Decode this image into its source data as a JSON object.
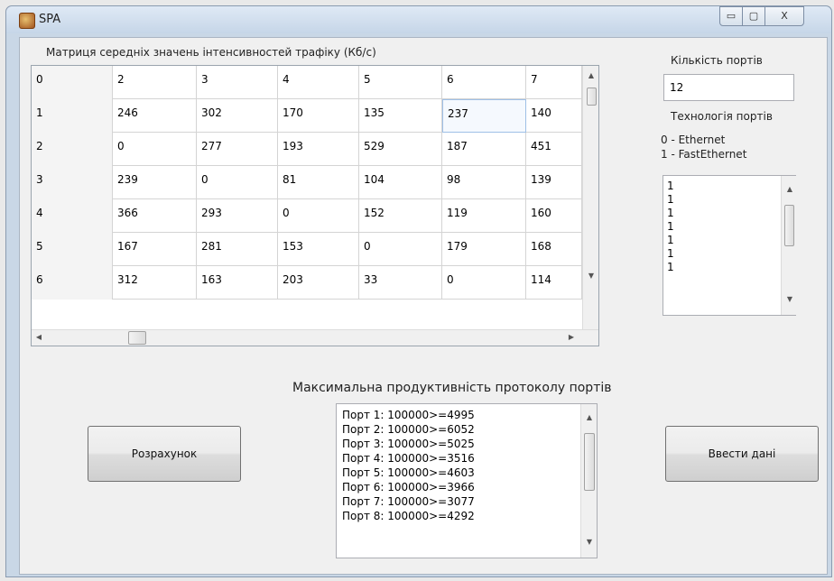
{
  "window": {
    "title": "SPA",
    "min_glyph": "▭",
    "max_glyph": "▢",
    "close_glyph": "X"
  },
  "matrix": {
    "title": "Матриця середніх значень інтенсивностей трафіку (Кб/с)",
    "columns": [
      "0",
      "2",
      "3",
      "4",
      "5",
      "6",
      "7"
    ],
    "rows": [
      [
        "1",
        "246",
        "302",
        "170",
        "135",
        "237",
        "140"
      ],
      [
        "2",
        "0",
        "277",
        "193",
        "529",
        "187",
        "451"
      ],
      [
        "3",
        "239",
        "0",
        "81",
        "104",
        "98",
        "139"
      ],
      [
        "4",
        "366",
        "293",
        "0",
        "152",
        "119",
        "160"
      ],
      [
        "5",
        "167",
        "281",
        "153",
        "0",
        "179",
        "168"
      ],
      [
        "6",
        "312",
        "163",
        "203",
        "33",
        "0",
        "114"
      ]
    ]
  },
  "ports": {
    "count_label": "Кількість портів",
    "count_value": "12",
    "tech_label": "Технологія портів",
    "tech_legend": [
      "0 - Ethernet",
      "1 - FastEthernet"
    ],
    "tech_values": [
      "1",
      "1",
      "1",
      "1",
      "1",
      "1",
      "1"
    ]
  },
  "output": {
    "title": "Максимальна продуктивність протоколу портів",
    "lines": [
      "Порт 1: 100000>=4995",
      "Порт 2: 100000>=6052",
      "Порт 3: 100000>=5025",
      "Порт 4: 100000>=3516",
      "Порт 5: 100000>=4603",
      "Порт 6: 100000>=3966",
      "Порт 7: 100000>=3077",
      "Порт 8: 100000>=4292"
    ]
  },
  "buttons": {
    "calculate": "Розрахунок",
    "enter_data": "Ввести дані"
  }
}
